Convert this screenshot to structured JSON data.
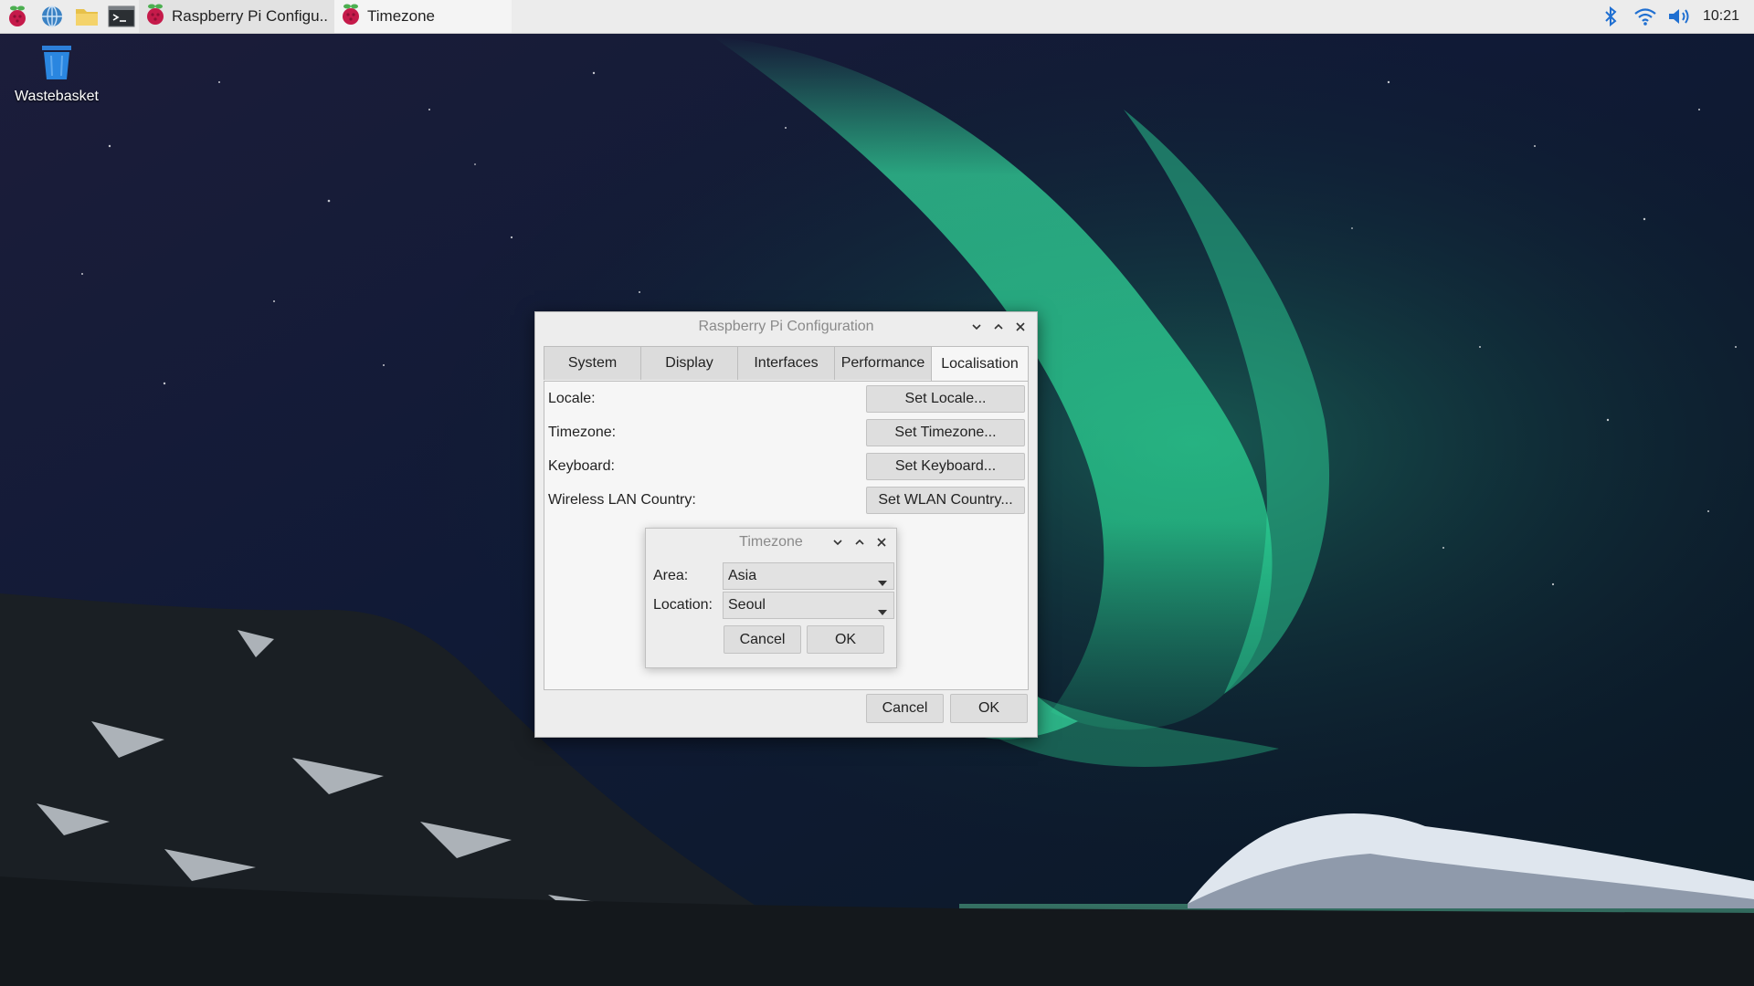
{
  "taskbar": {
    "launchers": [
      "raspberry-menu-icon",
      "web-browser-icon",
      "file-manager-icon",
      "terminal-icon"
    ],
    "windows": [
      {
        "label": "Raspberry Pi Configu...",
        "icon": "raspberry-icon"
      },
      {
        "label": "Timezone",
        "icon": "raspberry-icon"
      }
    ],
    "tray": [
      "bluetooth-icon",
      "wifi-icon",
      "volume-icon"
    ],
    "clock": "10:21"
  },
  "desktop": {
    "icons": [
      {
        "label": "Wastebasket",
        "icon": "wastebasket-icon"
      }
    ]
  },
  "config_dialog": {
    "title": "Raspberry Pi Configuration",
    "tabs": [
      {
        "label": "System"
      },
      {
        "label": "Display"
      },
      {
        "label": "Interfaces"
      },
      {
        "label": "Performance"
      },
      {
        "label": "Localisation"
      }
    ],
    "active_tab": "Localisation",
    "rows": [
      {
        "label": "Locale:",
        "button": "Set Locale..."
      },
      {
        "label": "Timezone:",
        "button": "Set Timezone..."
      },
      {
        "label": "Keyboard:",
        "button": "Set Keyboard..."
      },
      {
        "label": "Wireless LAN Country:",
        "button": "Set WLAN Country..."
      }
    ],
    "cancel_label": "Cancel",
    "ok_label": "OK"
  },
  "timezone_dialog": {
    "title": "Timezone",
    "area_label": "Area:",
    "area_value": "Asia",
    "location_label": "Location:",
    "location_value": "Seoul",
    "cancel_label": "Cancel",
    "ok_label": "OK"
  },
  "colors": {
    "aurora": "#2ee59a",
    "sky": "#0d1530",
    "raspberry": "#c51a4a"
  }
}
